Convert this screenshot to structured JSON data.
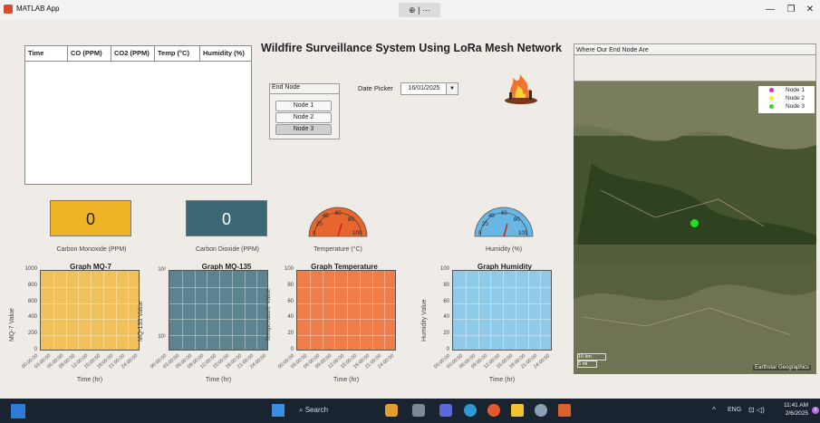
{
  "window": {
    "title": "MATLAB App"
  },
  "app": {
    "title": "Wildfire Surveillance System Using LoRa Mesh Network",
    "table": {
      "columns": [
        "Time",
        "CO (PPM)",
        "CO2 (PPM)",
        "Temp (°C)",
        "Humidity (%)"
      ]
    },
    "end_node": {
      "label": "End Node",
      "nodes": [
        "Node 1",
        "Node 2",
        "Node 3"
      ],
      "selected": "Node 3"
    },
    "date_picker": {
      "label": "Date Picker",
      "value": "16/01/2025"
    },
    "displays": [
      {
        "value": "0",
        "label": "Carbon Monoxide (PPM)",
        "color": "#f0b429"
      },
      {
        "value": "0",
        "label": "Carbon Dioxide (PPM)",
        "color": "#3b6673"
      }
    ],
    "gauges": [
      {
        "label": "Temperature (°C)",
        "ticks": [
          "0",
          "20",
          "40",
          "60",
          "80",
          "100"
        ],
        "value": 0,
        "color": "#e8662e"
      },
      {
        "label": "Humidity (%)",
        "ticks": [
          "0",
          "20",
          "40",
          "60",
          "80",
          "100"
        ],
        "value": 0,
        "color": "#6ab6e3"
      }
    ],
    "graphs": [
      {
        "title": "Graph MQ-7",
        "ylabel": "MQ-7 Value",
        "xlabel": "Time (hr)",
        "yticks": [
          "0",
          "200",
          "400",
          "600",
          "800",
          "1000"
        ],
        "color": "#f0c15a"
      },
      {
        "title": "Graph MQ-135",
        "ylabel": "MQ-135 Value",
        "xlabel": "Time (hr)",
        "yticks": [
          "10¹",
          "10²"
        ],
        "color": "#5b8490"
      },
      {
        "title": "Graph Temperature",
        "ylabel": "Temperature Value",
        "xlabel": "Time (hr)",
        "yticks": [
          "0",
          "20",
          "40",
          "60",
          "80",
          "100"
        ],
        "color": "#ef7d4a"
      },
      {
        "title": "Graph  Humidity",
        "ylabel": "Humidity Value",
        "xlabel": "Time (hr)",
        "yticks": [
          "0",
          "20",
          "40",
          "60",
          "80",
          "100"
        ],
        "color": "#8fcbe9"
      }
    ],
    "xticks": [
      "00:00:00",
      "03:00:00",
      "06:00:00",
      "09:00:00",
      "12:00:00",
      "15:00:00",
      "18:00:00",
      "21:00:00",
      "24:00:00"
    ],
    "map": {
      "header": "Where Our End Node Are",
      "legend": [
        {
          "name": "Node 1",
          "color": "#e020e0"
        },
        {
          "name": "Node 2",
          "color": "#f0f020"
        },
        {
          "name": "Node 3",
          "color": "#20e020"
        }
      ],
      "scale_km": "10 km",
      "scale_mi": "5 mi",
      "attribution": "Earthstar Geographics"
    }
  },
  "taskbar": {
    "search": "Search",
    "lang": "ENG",
    "time": "11:41 AM",
    "date": "2/6/2025",
    "badge": "5"
  }
}
